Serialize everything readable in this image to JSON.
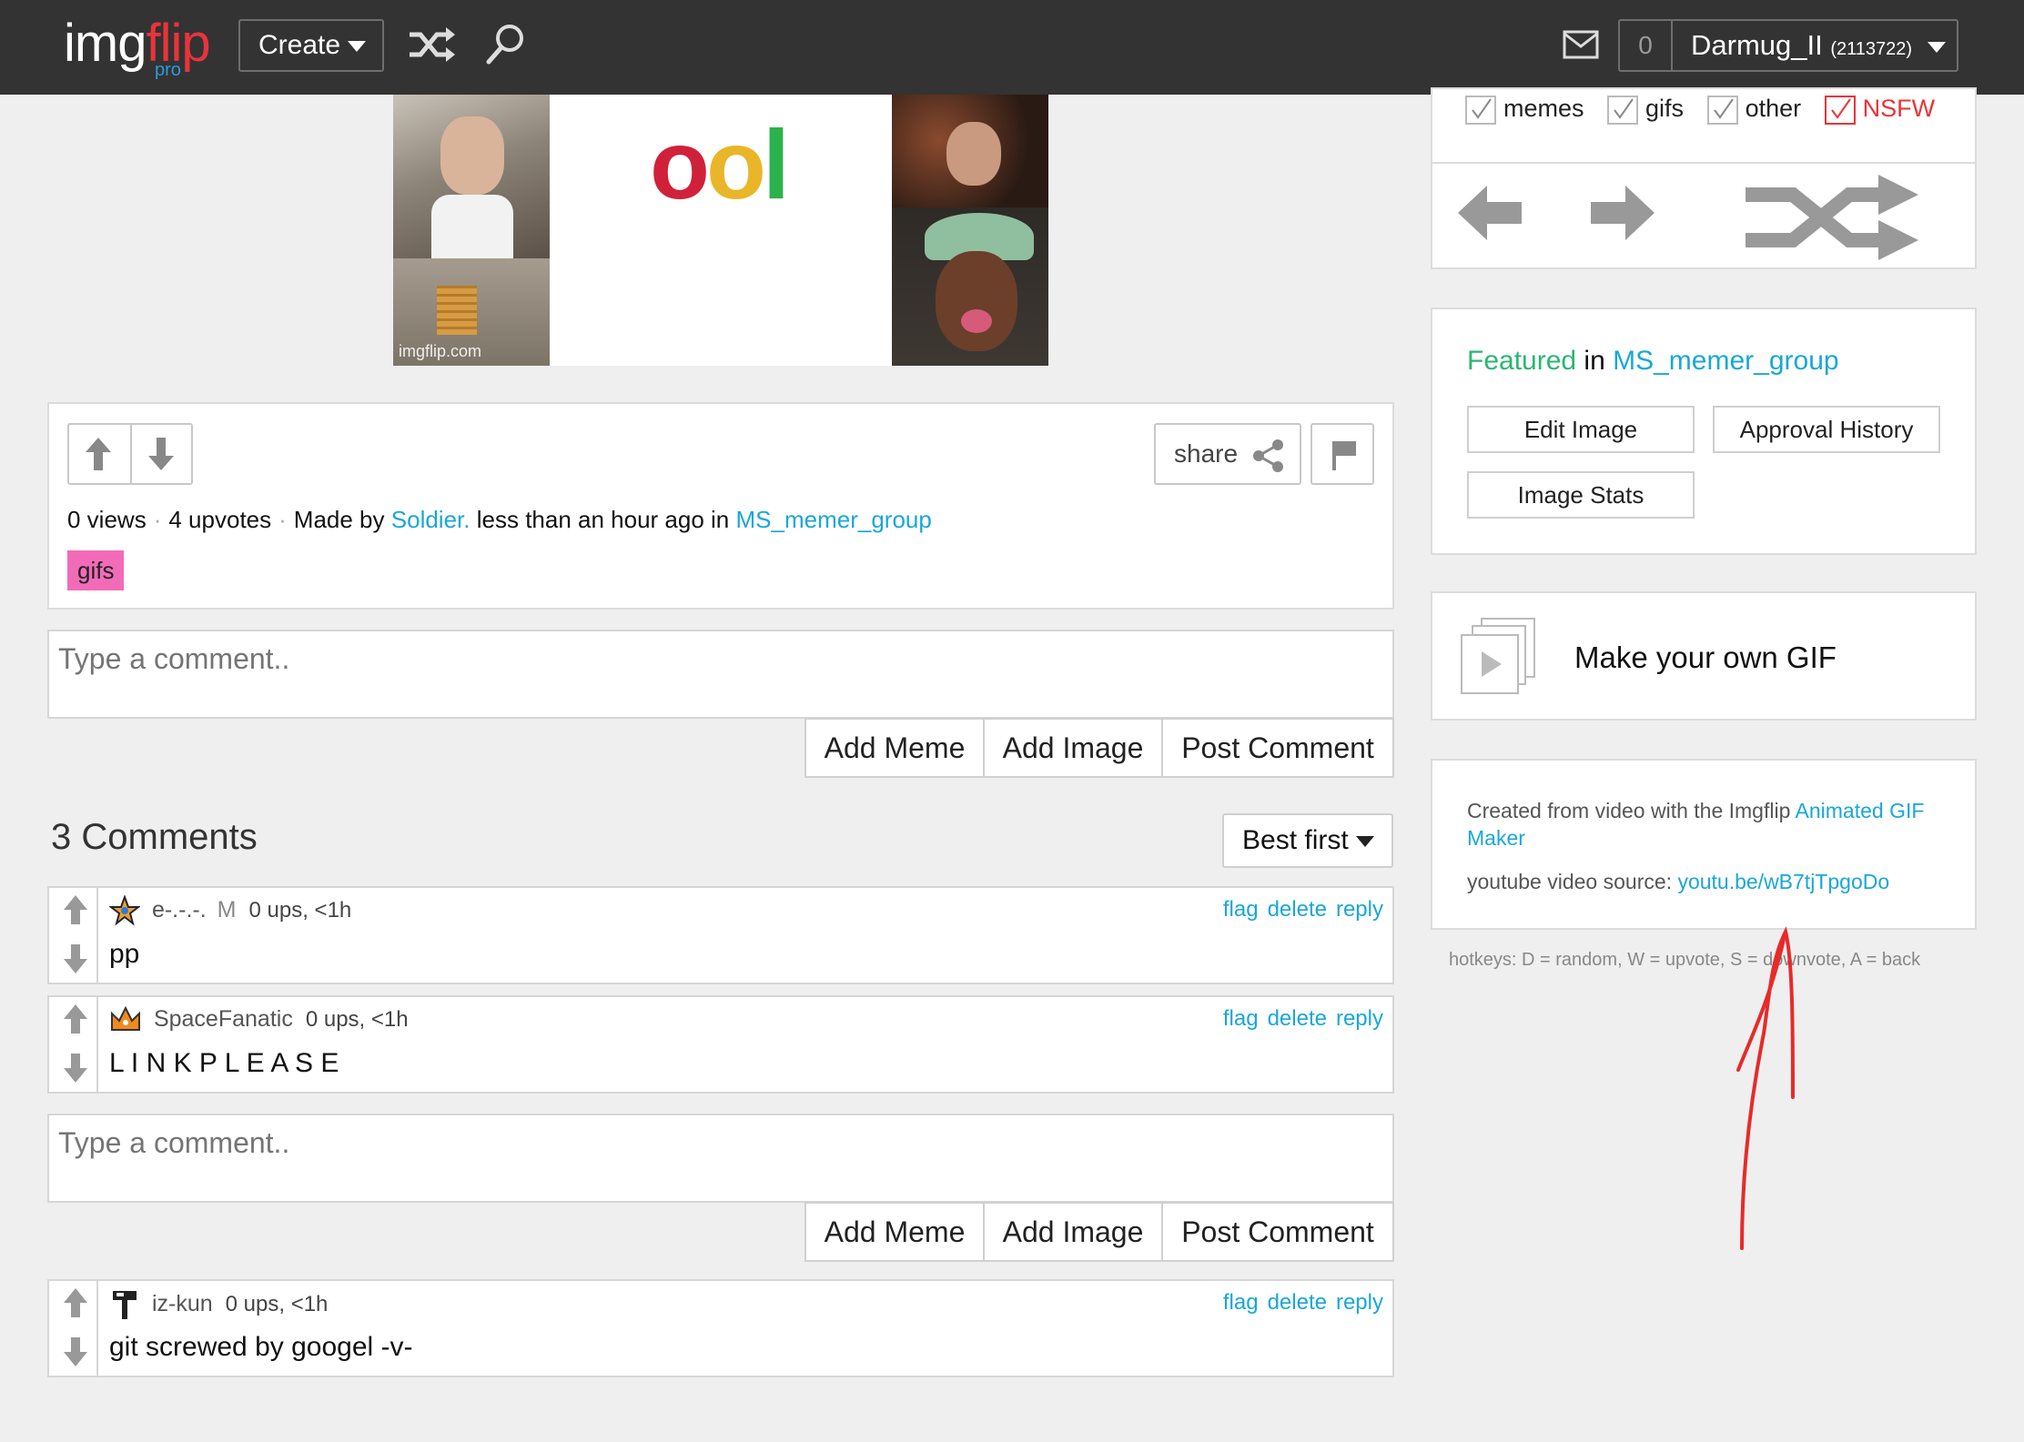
{
  "header": {
    "logo_img": "img",
    "logo_flip": "flip",
    "logo_pro": "pro",
    "create_label": "Create",
    "notification_count": "0",
    "username": "Darmug_II",
    "user_points": "(2113722)"
  },
  "image": {
    "watermark": "imgflip.com",
    "logo_text": "ool"
  },
  "post": {
    "share_label": "share",
    "views": "0 views",
    "upvotes": "4 upvotes",
    "made_by_prefix": "Made by",
    "author": "Soldier.",
    "time_text": "less than an hour ago in",
    "group": "MS_memer_group",
    "tag": "gifs"
  },
  "comment_box": {
    "placeholder": "Type a comment..",
    "add_meme": "Add Meme",
    "add_image": "Add Image",
    "post_comment": "Post Comment"
  },
  "comments_section": {
    "title": "3 Comments",
    "sort_label": "Best first",
    "flag": "flag",
    "delete": "delete",
    "reply": "reply",
    "items": [
      {
        "user": "e-.-.-.",
        "badge": "M",
        "ups": "0 ups, <1h",
        "text": "pp"
      },
      {
        "user": "SpaceFanatic",
        "ups": "0 ups, <1h",
        "text": "L I N K P L E A S E"
      },
      {
        "user": "iz-kun",
        "ups": "0 ups, <1h",
        "text": "git screwed by googel -v-"
      }
    ]
  },
  "sidebar": {
    "filters": {
      "memes": "memes",
      "gifs": "gifs",
      "other": "other",
      "nsfw": "NSFW"
    },
    "featured_word": "Featured",
    "in_word": "in",
    "featured_group": "MS_memer_group",
    "edit_image": "Edit Image",
    "approval_history": "Approval History",
    "image_stats": "Image Stats",
    "make_gif": "Make your own GIF",
    "created_from": "Created from video with the Imgflip",
    "gif_maker_link": "Animated GIF Maker",
    "video_source_label": "youtube video source:",
    "video_source_link": "youtu.be/wB7tjTpgoDo",
    "hotkeys": "hotkeys: D = random, W = upvote, S = downvote, A = back"
  },
  "colors": {
    "topbar": "#333333",
    "link": "#1aa7d8",
    "tag": "#f26bb9",
    "featured": "#2bb673",
    "nsfw": "#e8343a",
    "annotation": "#e82a2a"
  }
}
